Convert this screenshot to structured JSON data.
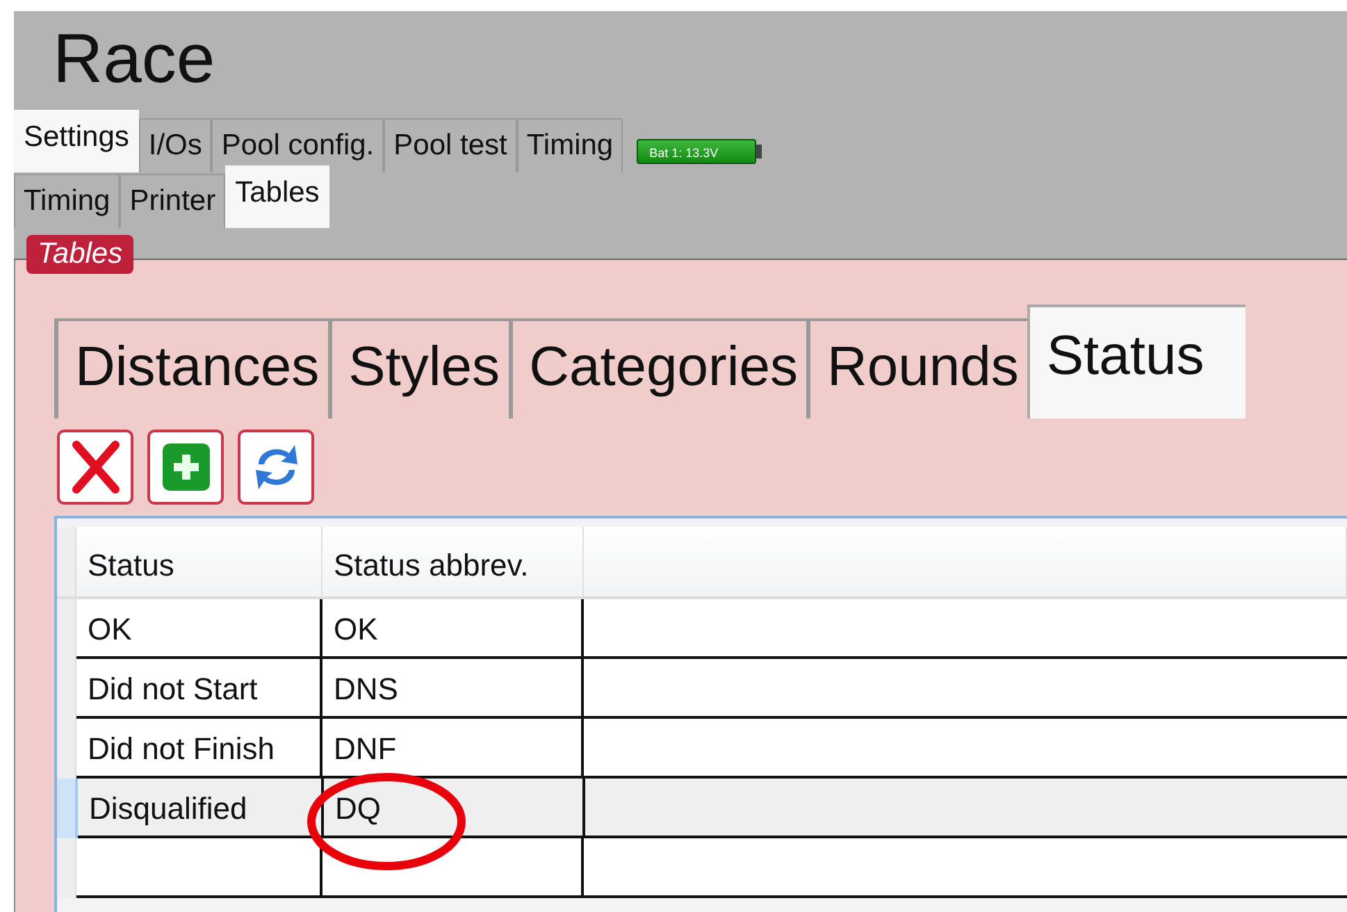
{
  "window": {
    "title": "Race"
  },
  "tabs": [
    {
      "label": "Settings",
      "selected": true
    },
    {
      "label": "I/Os",
      "selected": false
    },
    {
      "label": "Pool config.",
      "selected": false
    },
    {
      "label": "Pool test",
      "selected": false
    },
    {
      "label": "Timing",
      "selected": false
    }
  ],
  "battery": {
    "label": "Bat 1: 13.3V"
  },
  "subtabs": [
    {
      "label": "Timing",
      "selected": false
    },
    {
      "label": "Printer",
      "selected": false
    },
    {
      "label": "Tables",
      "selected": true
    }
  ],
  "group": {
    "title": "Tables"
  },
  "table_tabs": [
    {
      "label": "Distances",
      "selected": false
    },
    {
      "label": "Styles",
      "selected": false
    },
    {
      "label": "Categories",
      "selected": false
    },
    {
      "label": "Rounds",
      "selected": false
    },
    {
      "label": "Status",
      "selected": true
    }
  ],
  "toolbar": [
    {
      "kind": "delete"
    },
    {
      "kind": "add"
    },
    {
      "kind": "refresh"
    }
  ],
  "table": {
    "columns": [
      "Status",
      "Status abbrev."
    ],
    "rows": [
      {
        "cells": [
          "OK",
          "OK"
        ],
        "selected": false,
        "circled": false
      },
      {
        "cells": [
          "Did not Start",
          "DNS"
        ],
        "selected": false,
        "circled": false
      },
      {
        "cells": [
          "Did not Finish",
          "DNF"
        ],
        "selected": false,
        "circled": false
      },
      {
        "cells": [
          "Disqualified",
          "DQ"
        ],
        "selected": true,
        "circled": true
      },
      {
        "cells": [],
        "selected": false,
        "circled": false
      }
    ]
  }
}
